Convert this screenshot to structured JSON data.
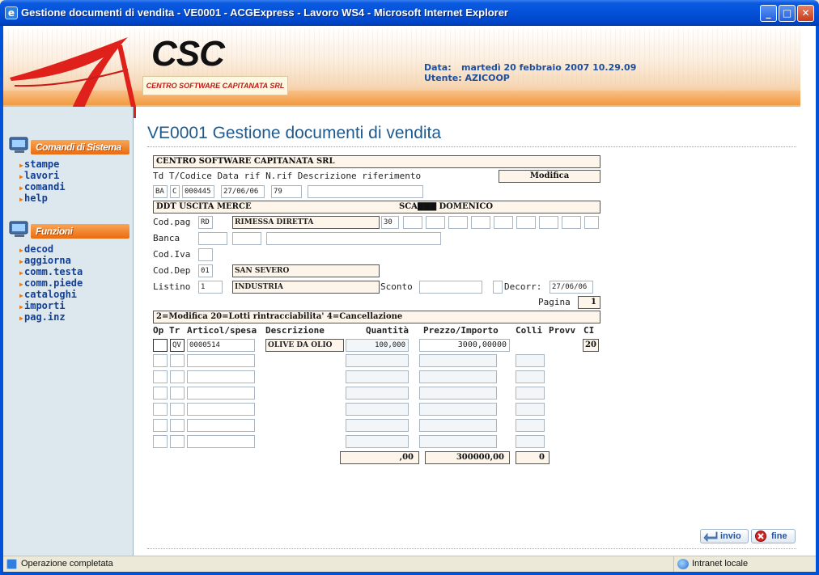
{
  "window": {
    "title": "Gestione documenti di vendita - VE0001 - ACGExpress - Lavoro WS4 - Microsoft Internet Explorer",
    "icon": "ie-icon",
    "controls": [
      "minimize",
      "maximize",
      "close"
    ]
  },
  "header": {
    "logo_text": "CSC",
    "logo_sub": "CENTRO SOFTWARE CAPITANATA SRL",
    "date_label": "Data:",
    "date_value": "martedì 20 febbraio 2007 10.29.09",
    "user_label": "Utente:",
    "user_value": "AZICOOP"
  },
  "sidebar": {
    "section1_title": "Comandi di Sistema",
    "section1_items": [
      "stampe",
      "lavori",
      "comandi",
      "help"
    ],
    "section2_title": "Funzioni",
    "section2_items": [
      "decod",
      "aggiorna",
      "comm.testa",
      "comm.piede",
      "cataloghi",
      "importi",
      "pag.inz"
    ]
  },
  "main": {
    "title": "VE0001 Gestione documenti di vendita",
    "company": "CENTRO SOFTWARE CAPITANATA SRL",
    "doc_header_label": "Td T/Codice Data rif N.rif Descrizione riferimento",
    "mode": "Modifica",
    "doc": {
      "td": "BA",
      "t": "C",
      "codice": "000445",
      "data_rif": "27/06/06",
      "n_rif": "79",
      "descr_rif": ""
    },
    "ddt_label": "DDT USCITA MERCE",
    "customer": "SCA▇▇▇ DOMENICO",
    "codpag_label": "Cod.pag",
    "codpag": "RD",
    "codpag_descr": "RIMESSA DIRETTA",
    "codpag_days": "30",
    "banca_label": "Banca",
    "codiva_label": "Cod.Iva",
    "coddep_label": "Cod.Dep",
    "coddep": "01",
    "coddep_descr": "SAN SEVERO",
    "listino_label": "Listino",
    "listino": "1",
    "listino_descr": "INDUSTRIA",
    "sconto_label": "Sconto",
    "decorr_label": "Decorr:",
    "decorr": "27/06/06",
    "pagina_label": "Pagina",
    "pagina": "1",
    "options_bar": "2=Modifica  20=Lotti rintracciabilita' 4=Cancellazione",
    "columns": [
      "Op",
      "Tr",
      "Articol/spesa",
      "Descrizione",
      "Quantità",
      "Prezzo/Importo",
      "Colli",
      "Provv",
      "CI"
    ],
    "rows": [
      {
        "op": "",
        "tr": "QV",
        "articolo": "0000514",
        "descrizione": "OLIVE DA OLIO",
        "quantita": "100,000",
        "prezzo": "3000,00000",
        "colli": "",
        "ci": "20"
      }
    ],
    "totals": {
      "quantita": ",00",
      "importo": "300000,00",
      "colli": "0"
    }
  },
  "buttons": {
    "invio": "invio",
    "fine": "fine"
  },
  "statusbar": {
    "text": "Operazione completata",
    "zone": "Intranet locale"
  }
}
